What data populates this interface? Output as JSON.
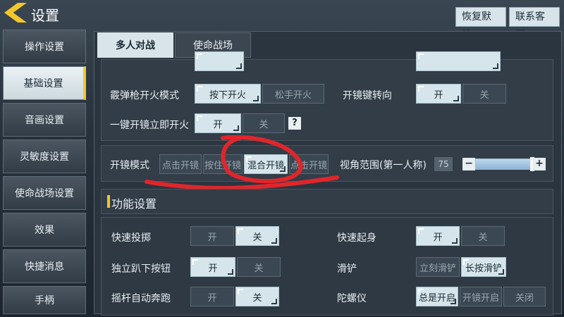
{
  "header": {
    "title": "设置",
    "reset_label": "恢复默认",
    "support_label": "联系客服"
  },
  "sidebar": {
    "items": [
      {
        "label": "操作设置"
      },
      {
        "label": "基础设置"
      },
      {
        "label": "音画设置"
      },
      {
        "label": "灵敏度设置"
      },
      {
        "label": "使命战场设置"
      },
      {
        "label": "效果"
      },
      {
        "label": "快捷消息"
      },
      {
        "label": "手柄"
      }
    ],
    "active_index": 1
  },
  "tabs": [
    {
      "label": "多人对战"
    },
    {
      "label": "使命战场"
    }
  ],
  "basic": {
    "shotgun_label": "霰弹枪开火模式",
    "shotgun_opt1": "按下开火",
    "shotgun_opt2": "松手开火",
    "scope_toggle_label": "开镜键转向",
    "on": "开",
    "off": "关",
    "oneclick_label": "一键开镜立即开火",
    "help": "?"
  },
  "scope": {
    "mode_label": "开镜模式",
    "opt1": "点击开镜",
    "opt2": "按住开镜",
    "opt3": "混合开镜",
    "opt4": "点击开镜",
    "fov_label": "视角范围(第一人称)",
    "fov_value": "75",
    "fov_fraction": 0.95,
    "minus": "−",
    "plus": "+"
  },
  "func": {
    "title": "功能设置",
    "quick_throw_label": "快速投掷",
    "quick_rise_label": "快速起身",
    "prone_label": "独立趴下按钮",
    "slide_label": "滑铲",
    "slide_opt1": "立刻滑铲",
    "slide_opt2": "长按滑铲",
    "autorun_label": "摇杆自动奔跑",
    "gyro_label": "陀螺仪",
    "gyro_opt1": "总是开启",
    "gyro_opt2": "开镜开启",
    "gyro_opt3": "关闭"
  },
  "colors": {
    "accent": "#f3c62a",
    "annotation": "#e0262b"
  }
}
